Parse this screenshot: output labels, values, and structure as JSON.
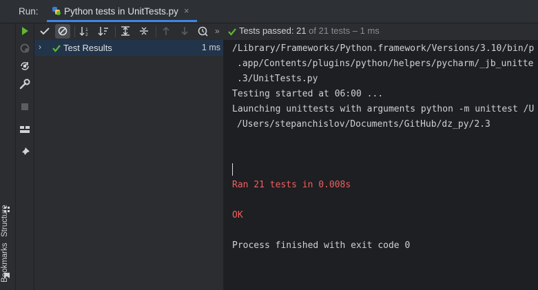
{
  "run_header": {
    "label": "Run:",
    "tab_title": "Python tests in UnitTests.py",
    "tab_close": "×",
    "tab_icon": "python-tests-icon"
  },
  "left_strip": {
    "structure_label": "Structure",
    "bookmarks_label": "Bookmarks"
  },
  "runner_toolbar": {
    "icons": [
      "run-icon",
      "rerun-failed-icon",
      "toggle-auto-test-icon",
      "wrench-icon",
      "stop-icon",
      "layout-icon",
      "pin-icon"
    ]
  },
  "tests_toolbar": {
    "icons": [
      "show-passed-icon",
      "show-ignored-icon",
      "sort-alpha-icon",
      "sort-duration-icon",
      "expand-all-icon",
      "collapse-all-icon",
      "prev-failed-icon",
      "next-failed-icon",
      "history-icon"
    ],
    "more": "»",
    "status_passed": "Tests passed: 21",
    "status_rest": " of 21 tests – 1 ms"
  },
  "tree": {
    "expander": "›",
    "label": "Test Results",
    "time": "1 ms"
  },
  "console": {
    "lines": [
      "/Library/Frameworks/Python.framework/Versions/3.10/bin/p",
      ".app/Contents/plugins/python/helpers/pycharm/_jb_unitte",
      ".3/UnitTests.py",
      "Testing started at 06:00 ...",
      "Launching unittests with arguments python -m unittest /U",
      "/Users/stepanchislov/Documents/GitHub/dz_py/2.3",
      "Ran 21 tests in 0.008s",
      "OK",
      "Process finished with exit code 0"
    ]
  },
  "colors": {
    "accent": "#3d87e6",
    "success": "#5fb832",
    "error": "#f25e5e",
    "selection": "#22344a"
  }
}
